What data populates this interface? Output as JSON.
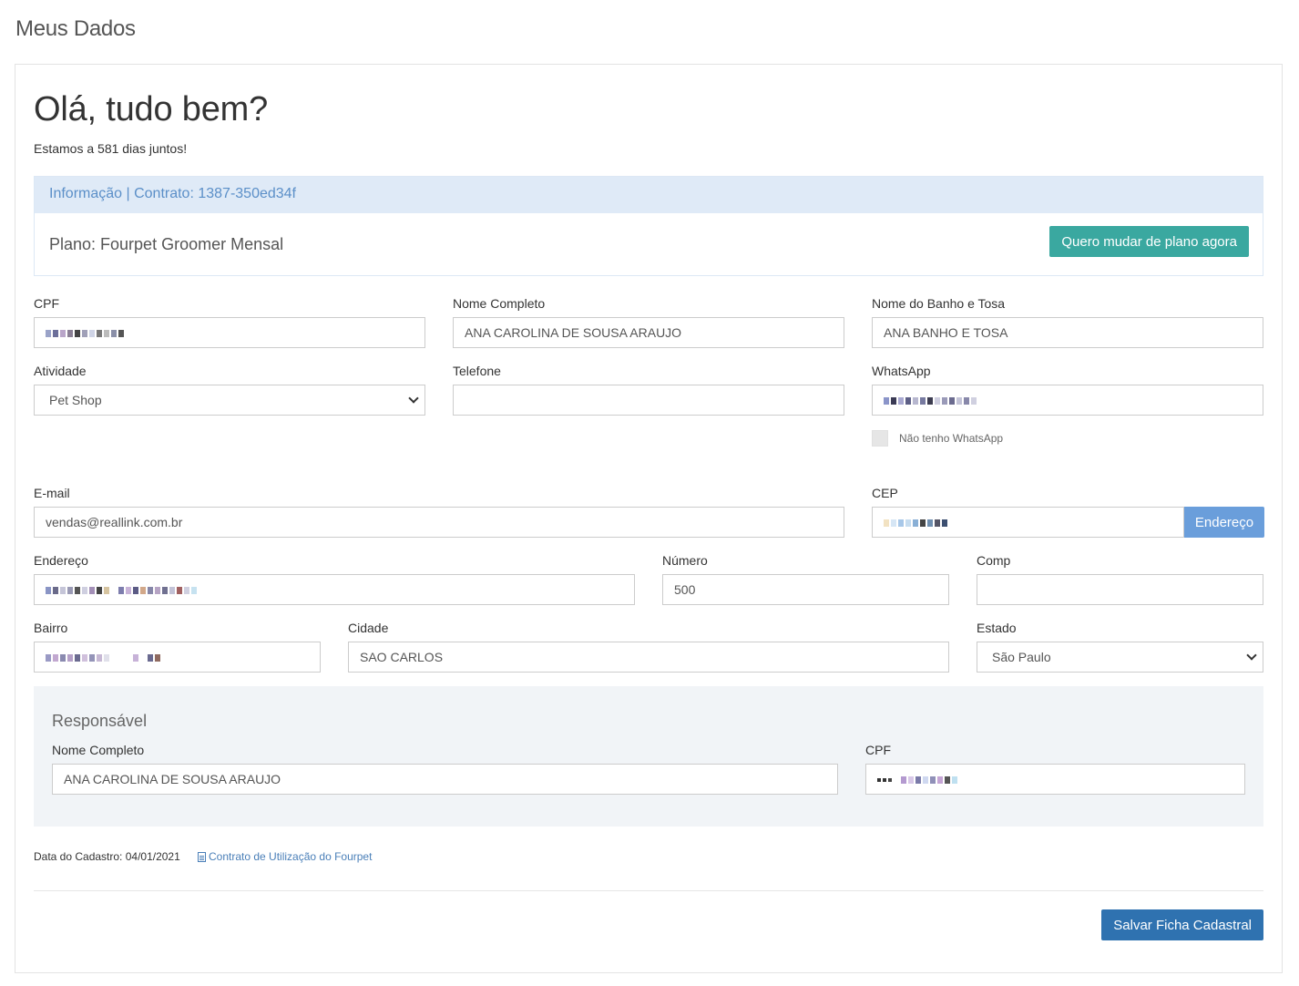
{
  "page": {
    "title": "Meus Dados"
  },
  "greeting": {
    "title": "Olá, tudo bem?",
    "days": "Estamos a 581 dias juntos!"
  },
  "info": {
    "heading": "Informação | Contrato: 1387-350ed34f",
    "plan": "Plano: Fourpet Groomer Mensal",
    "change_plan_label": "Quero mudar de plano agora"
  },
  "form": {
    "cpf": {
      "label": "CPF",
      "value": ""
    },
    "nome_completo": {
      "label": "Nome Completo",
      "value": "ANA CAROLINA DE SOUSA ARAUJO"
    },
    "nome_banho_tosa": {
      "label": "Nome do Banho e Tosa",
      "value": "ANA BANHO E TOSA"
    },
    "atividade": {
      "label": "Atividade",
      "value": "Pet Shop"
    },
    "telefone": {
      "label": "Telefone",
      "value": ""
    },
    "whatsapp": {
      "label": "WhatsApp",
      "value": ""
    },
    "nao_whatsapp": {
      "label": "Não tenho WhatsApp"
    },
    "email": {
      "label": "E-mail",
      "value": "vendas@reallink.com.br"
    },
    "cep": {
      "label": "CEP",
      "value": "",
      "button_label": "Endereço"
    },
    "endereco": {
      "label": "Endereço",
      "value": ""
    },
    "numero": {
      "label": "Número",
      "value": "500"
    },
    "comp": {
      "label": "Comp",
      "value": ""
    },
    "bairro": {
      "label": "Bairro",
      "value": ""
    },
    "cidade": {
      "label": "Cidade",
      "value": "SAO CARLOS"
    },
    "estado": {
      "label": "Estado",
      "value": "São Paulo"
    }
  },
  "responsavel": {
    "title": "Responsável",
    "nome": {
      "label": "Nome Completo",
      "value": "ANA CAROLINA DE SOUSA ARAUJO"
    },
    "cpf": {
      "label": "CPF",
      "value": ""
    }
  },
  "footer": {
    "data_cadastro": "Data do Cadastro: 04/01/2021",
    "contract_link": "Contrato de Utilização do Fourpet",
    "save_label": "Salvar Ficha Cadastral"
  },
  "colors": {
    "teal_button": "#3aa8a0",
    "primary_button": "#2f72b0",
    "info_heading_bg": "#dfeaf7",
    "info_heading_text": "#5b8fc8",
    "cep_button": "#6a9edb",
    "responsavel_bg": "#f1f4f7"
  }
}
